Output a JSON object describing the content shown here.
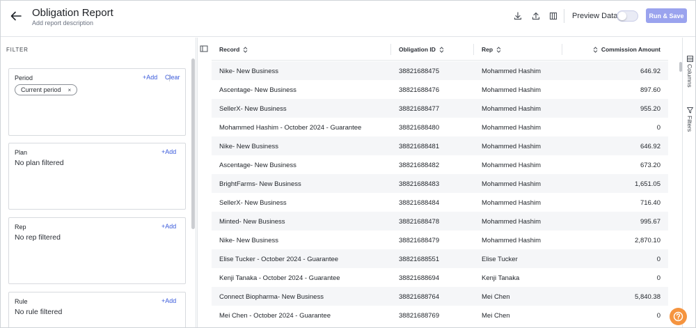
{
  "header": {
    "title": "Obligation Report",
    "description": "Add report description",
    "preview_label": "Preview Data",
    "run_label": "Run & Save",
    "preview_enabled": false
  },
  "filter": {
    "heading": "FILTER",
    "cards": [
      {
        "title": "Period",
        "add": "+Add",
        "clear": "Clear",
        "chip": "Current period",
        "chip_remove": "×"
      },
      {
        "title": "Plan",
        "add": "+Add",
        "empty": "No plan filtered"
      },
      {
        "title": "Rep",
        "add": "+Add",
        "empty": "No rep filtered"
      },
      {
        "title": "Rule",
        "add": "+Add",
        "empty": "No rule filtered"
      }
    ]
  },
  "table": {
    "columns": [
      "Record",
      "Obligation ID",
      "Rep",
      "Commission Amount"
    ],
    "rows": [
      [
        "Nike- New Business",
        "38821688475",
        "Mohammed Hashim",
        "646.92"
      ],
      [
        "Ascentage- New Business",
        "38821688476",
        "Mohammed Hashim",
        "897.60"
      ],
      [
        "SellerX- New Business",
        "38821688477",
        "Mohammed Hashim",
        "955.20"
      ],
      [
        "Mohammed Hashim - October 2024 - Guarantee",
        "38821688480",
        "Mohammed Hashim",
        "0"
      ],
      [
        "Nike- New Business",
        "38821688481",
        "Mohammed Hashim",
        "646.92"
      ],
      [
        "Ascentage- New Business",
        "38821688482",
        "Mohammed Hashim",
        "673.20"
      ],
      [
        "BrightFarms- New Business",
        "38821688483",
        "Mohammed Hashim",
        "1,651.05"
      ],
      [
        "SellerX- New Business",
        "38821688484",
        "Mohammed Hashim",
        "716.40"
      ],
      [
        "Minted- New Business",
        "38821688478",
        "Mohammed Hashim",
        "995.67"
      ],
      [
        "Nike- New Business",
        "38821688479",
        "Mohammed Hashim",
        "2,870.10"
      ],
      [
        "Elise Tucker - October 2024 - Guarantee",
        "38821688551",
        "Elise Tucker",
        "0"
      ],
      [
        "Kenji Tanaka - October 2024 - Guarantee",
        "38821688694",
        "Kenji Tanaka",
        "0"
      ],
      [
        "Connect Biopharma- New Business",
        "38821688764",
        "Mei Chen",
        "5,840.38"
      ],
      [
        "Mei Chen - October 2024 - Guarantee",
        "38821688769",
        "Mei Chen",
        "0"
      ]
    ]
  },
  "side_rail": {
    "columns_label": "Columns",
    "filters_label": "Filters"
  },
  "colors": {
    "accent": "#3b5bdb",
    "run_button": "#9aa3ee",
    "help_button": "#f5943f",
    "row_alt": "#f5f6f8"
  },
  "icons": {
    "back": "arrow-left-icon",
    "download": "download-icon",
    "share": "upload-icon",
    "layout": "columns-layout-icon",
    "help": "question-icon"
  }
}
